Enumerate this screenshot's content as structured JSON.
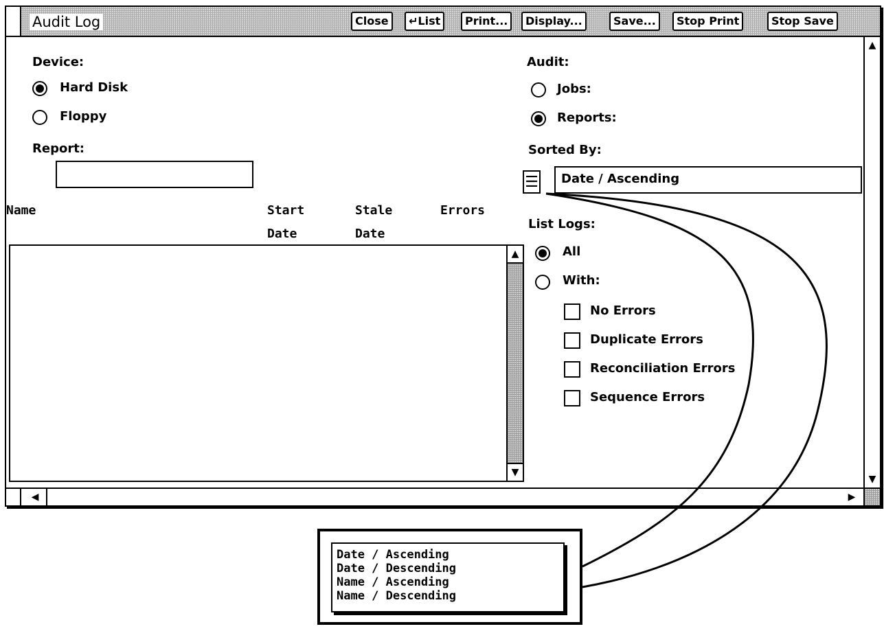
{
  "window": {
    "title": "Audit Log"
  },
  "toolbar": {
    "close": "Close",
    "list": "↵List",
    "print": "Print...",
    "display": "Display...",
    "save": "Save...",
    "stop_print": "Stop Print",
    "stop_save": "Stop Save"
  },
  "device": {
    "label": "Device:",
    "options": [
      {
        "label": "Hard Disk",
        "selected": true
      },
      {
        "label": "Floppy",
        "selected": false
      }
    ]
  },
  "report": {
    "label": "Report:",
    "value": ""
  },
  "audit": {
    "label": "Audit:",
    "options": [
      {
        "label": "Jobs:",
        "selected": false
      },
      {
        "label": "Reports:",
        "selected": true
      }
    ]
  },
  "sorted_by": {
    "label": "Sorted By:",
    "value": "Date / Ascending"
  },
  "table": {
    "col_name": "Name",
    "col_start": "Start",
    "col_start2": "Date",
    "col_stale": "Stale",
    "col_stale2": "Date",
    "col_errors": "Errors",
    "rows": []
  },
  "list_logs": {
    "label": "List Logs:",
    "all": "All",
    "with": "With:",
    "all_selected": true,
    "filters": [
      {
        "label": "No Errors",
        "checked": false
      },
      {
        "label": "Duplicate Errors",
        "checked": false
      },
      {
        "label": "Reconciliation Errors",
        "checked": false
      },
      {
        "label": "Sequence Errors",
        "checked": false
      }
    ]
  },
  "sort_menu": {
    "options": [
      "Date / Ascending",
      "Date / Descending",
      "Name / Ascending",
      "Name / Descending"
    ]
  },
  "icons": {
    "up": "up-arrow-icon",
    "down": "down-arrow-icon",
    "left": "left-arrow-icon",
    "right": "right-arrow-icon",
    "menu": "menu-icon"
  }
}
